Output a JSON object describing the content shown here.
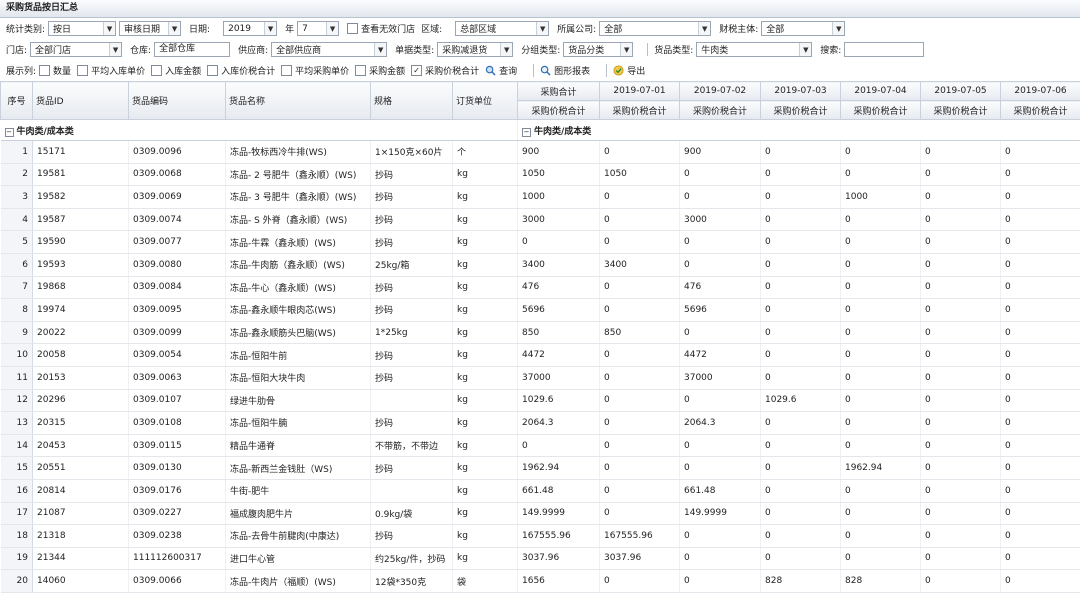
{
  "title": "采购货品按日汇总",
  "filters": {
    "stat_type_label": "统计类别:",
    "stat_type_value": "按日",
    "date_type_value": "审核日期",
    "date_label": "日期:",
    "year_value": "2019",
    "year_label": "年",
    "month_value": "7",
    "show_invalid_store": "查看无效门店",
    "region_label": "区域:",
    "region_value": "总部区域",
    "company_label": "所属公司:",
    "company_value": "全部",
    "tax_entity_label": "财税主体:",
    "tax_entity_value": "全部",
    "store_label": "门店:",
    "store_value": "全部门店",
    "warehouse_label": "仓库:",
    "warehouse_value": "全部仓库",
    "supplier_label": "供应商:",
    "supplier_value": "全部供应商",
    "doc_type_label": "单据类型:",
    "doc_type_value": "采购减退货",
    "group_type_label": "分组类型:",
    "group_type_value": "货品分类",
    "goods_type_label": "货品类型:",
    "goods_type_value": "牛肉类",
    "search_label": "搜索:",
    "search_value": "",
    "display_label": "展示列:",
    "col_qty": "数量",
    "col_avg_in_price": "平均入库单价",
    "col_in_amount": "入库金额",
    "col_in_tax_total": "入库价税合计",
    "col_avg_purchase_price": "平均采购单价",
    "col_purchase_amount": "采购金额",
    "col_purchase_tax_total": "采购价税合计",
    "query_btn": "查询",
    "chart_btn": "图形报表",
    "export_btn": "导出"
  },
  "table": {
    "headers": {
      "seq": "序号",
      "goods_id": "货品ID",
      "goods_code": "货品编码",
      "goods_name": "货品名称",
      "spec": "规格",
      "unit": "订货单位",
      "total": "采购合计",
      "sub": "采购价税合计"
    },
    "dates": [
      "2019-07-01",
      "2019-07-02",
      "2019-07-03",
      "2019-07-04",
      "2019-07-05",
      "2019-07-06"
    ],
    "group_label": "牛肉类/成本类",
    "rows": [
      {
        "n": "1",
        "id": "15171",
        "code": "0309.0096",
        "name": "冻品-牧标西冷牛排(WS)",
        "spec": "1×150克×60片",
        "unit": "个",
        "total": "900",
        "d": [
          "0",
          "900",
          "0",
          "0",
          "0",
          "0"
        ]
      },
      {
        "n": "2",
        "id": "19581",
        "code": "0309.0068",
        "name": "冻品- 2 号肥牛（鑫永顺）(WS)",
        "spec": "抄码",
        "unit": "kg",
        "total": "1050",
        "d": [
          "1050",
          "0",
          "0",
          "0",
          "0",
          "0"
        ]
      },
      {
        "n": "3",
        "id": "19582",
        "code": "0309.0069",
        "name": "冻品- 3 号肥牛（鑫永顺）(WS)",
        "spec": "抄码",
        "unit": "kg",
        "total": "1000",
        "d": [
          "0",
          "0",
          "0",
          "1000",
          "0",
          "0"
        ]
      },
      {
        "n": "4",
        "id": "19587",
        "code": "0309.0074",
        "name": "冻品- S 外脊（鑫永顺）(WS)",
        "spec": "抄码",
        "unit": "kg",
        "total": "3000",
        "d": [
          "0",
          "3000",
          "0",
          "0",
          "0",
          "0"
        ]
      },
      {
        "n": "5",
        "id": "19590",
        "code": "0309.0077",
        "name": "冻品-牛霖（鑫永顺）(WS)",
        "spec": "抄码",
        "unit": "kg",
        "total": "0",
        "d": [
          "0",
          "0",
          "0",
          "0",
          "0",
          "0"
        ]
      },
      {
        "n": "6",
        "id": "19593",
        "code": "0309.0080",
        "name": "冻品-牛肉筋（鑫永顺）(WS)",
        "spec": "25kg/箱",
        "unit": "kg",
        "total": "3400",
        "d": [
          "3400",
          "0",
          "0",
          "0",
          "0",
          "0"
        ]
      },
      {
        "n": "7",
        "id": "19868",
        "code": "0309.0084",
        "name": "冻品-牛心（鑫永顺）(WS)",
        "spec": "抄码",
        "unit": "kg",
        "total": "476",
        "d": [
          "0",
          "476",
          "0",
          "0",
          "0",
          "0"
        ]
      },
      {
        "n": "8",
        "id": "19974",
        "code": "0309.0095",
        "name": "冻品-鑫永顺牛眼肉芯(WS)",
        "spec": "抄码",
        "unit": "kg",
        "total": "5696",
        "d": [
          "0",
          "5696",
          "0",
          "0",
          "0",
          "0"
        ]
      },
      {
        "n": "9",
        "id": "20022",
        "code": "0309.0099",
        "name": "冻品-鑫永顺筋头巴脑(WS)",
        "spec": "1*25kg",
        "unit": "kg",
        "total": "850",
        "d": [
          "850",
          "0",
          "0",
          "0",
          "0",
          "0"
        ]
      },
      {
        "n": "10",
        "id": "20058",
        "code": "0309.0054",
        "name": "冻品-恒阳牛前",
        "spec": "抄码",
        "unit": "kg",
        "total": "4472",
        "d": [
          "0",
          "4472",
          "0",
          "0",
          "0",
          "0"
        ]
      },
      {
        "n": "11",
        "id": "20153",
        "code": "0309.0063",
        "name": "冻品-恒阳大块牛肉",
        "spec": "抄码",
        "unit": "kg",
        "total": "37000",
        "d": [
          "0",
          "37000",
          "0",
          "0",
          "0",
          "0"
        ]
      },
      {
        "n": "12",
        "id": "20296",
        "code": "0309.0107",
        "name": "绿进牛肋骨",
        "spec": "",
        "unit": "kg",
        "total": "1029.6",
        "d": [
          "0",
          "0",
          "1029.6",
          "0",
          "0",
          "0"
        ]
      },
      {
        "n": "13",
        "id": "20315",
        "code": "0309.0108",
        "name": "冻品-恒阳牛腩",
        "spec": "抄码",
        "unit": "kg",
        "total": "2064.3",
        "d": [
          "0",
          "2064.3",
          "0",
          "0",
          "0",
          "0"
        ]
      },
      {
        "n": "14",
        "id": "20453",
        "code": "0309.0115",
        "name": "精品牛通脊",
        "spec": "不带筋，不带边",
        "unit": "kg",
        "total": "0",
        "d": [
          "0",
          "0",
          "0",
          "0",
          "0",
          "0"
        ]
      },
      {
        "n": "15",
        "id": "20551",
        "code": "0309.0130",
        "name": "冻品-新西兰金钱肚（WS)",
        "spec": "抄码",
        "unit": "kg",
        "total": "1962.94",
        "d": [
          "0",
          "0",
          "0",
          "1962.94",
          "0",
          "0"
        ]
      },
      {
        "n": "16",
        "id": "20814",
        "code": "0309.0176",
        "name": "牛街-肥牛",
        "spec": "",
        "unit": "kg",
        "total": "661.48",
        "d": [
          "0",
          "661.48",
          "0",
          "0",
          "0",
          "0"
        ]
      },
      {
        "n": "17",
        "id": "21087",
        "code": "0309.0227",
        "name": "福成腹肉肥牛片",
        "spec": "0.9kg/袋",
        "unit": "kg",
        "total": "149.9999",
        "d": [
          "0",
          "149.9999",
          "0",
          "0",
          "0",
          "0"
        ]
      },
      {
        "n": "18",
        "id": "21318",
        "code": "0309.0238",
        "name": "冻品-去骨牛前腱肉(中康达)",
        "spec": "抄码",
        "unit": "kg",
        "total": "167555.96",
        "d": [
          "167555.96",
          "0",
          "0",
          "0",
          "0",
          "0"
        ]
      },
      {
        "n": "19",
        "id": "21344",
        "code": "111112600317",
        "name": "进口牛心管",
        "spec": "约25kg/件，抄码",
        "unit": "kg",
        "total": "3037.96",
        "d": [
          "3037.96",
          "0",
          "0",
          "0",
          "0",
          "0"
        ]
      },
      {
        "n": "20",
        "id": "14060",
        "code": "0309.0066",
        "name": "冻品-牛肉片（福顺）(WS)",
        "spec": "12袋*350克",
        "unit": "袋",
        "total": "1656",
        "d": [
          "0",
          "0",
          "828",
          "828",
          "0",
          "0"
        ]
      }
    ]
  }
}
